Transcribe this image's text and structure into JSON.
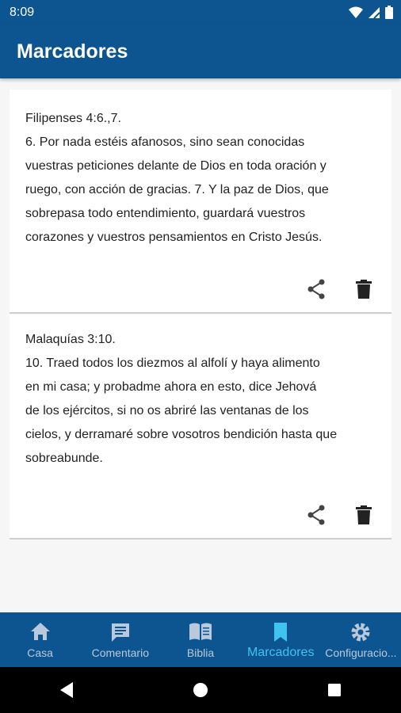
{
  "status_bar": {
    "time": "8:09"
  },
  "app_bar": {
    "title": "Marcadores"
  },
  "bookmarks": [
    {
      "reference": "Filipenses 4:6.,7.",
      "lines": [
        "6. Por nada estéis afanosos, sino sean conocidas",
        "vuestras peticiones delante de Dios en toda oración y",
        "ruego, con acción de gracias. 7. Y la paz de Dios, que",
        "sobrepasa todo entendimiento, guardará vuestros",
        "corazones y vuestros pensamientos en Cristo Jesús."
      ]
    },
    {
      "reference": "Malaquías 3:10.",
      "lines": [
        "10. Traed todos los diezmos al alfolí y haya alimento",
        "en mi casa; y probadme ahora en esto, dice Jehová",
        "de los ejércitos, si no os abriré las ventanas de los",
        "cielos, y derramaré sobre vosotros bendición hasta que",
        "sobreabunde."
      ]
    }
  ],
  "actions": {
    "share_icon": "share-icon",
    "delete_icon": "trash-icon"
  },
  "bottom_nav": {
    "items": [
      {
        "label": "Casa",
        "icon": "home-icon"
      },
      {
        "label": "Comentario",
        "icon": "comment-icon"
      },
      {
        "label": "Biblia",
        "icon": "book-icon"
      },
      {
        "label": "Marcadores",
        "icon": "bookmark-icon",
        "active": true
      },
      {
        "label": "Configuracio...",
        "icon": "gear-icon"
      }
    ]
  },
  "colors": {
    "primary": "#0d5590",
    "active_nav": "#3fc3f0",
    "inactive_nav": "#b9c9db",
    "background": "#f6f6f6"
  }
}
